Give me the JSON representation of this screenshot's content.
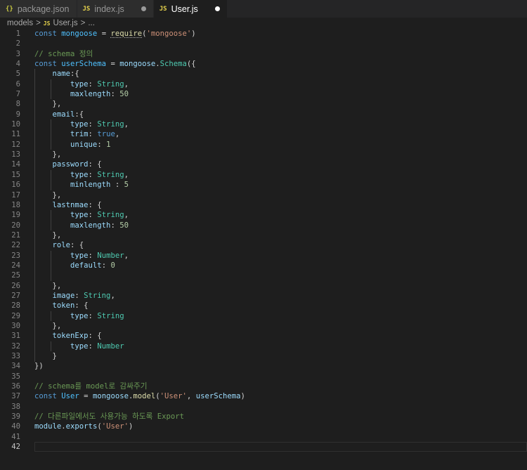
{
  "tabs": [
    {
      "icon": "{}",
      "label": "package.json",
      "active": false,
      "dirty": false
    },
    {
      "icon": "JS",
      "label": "index.js",
      "active": false,
      "dirty": true
    },
    {
      "icon": "JS",
      "label": "User.js",
      "active": true,
      "dirty": true
    }
  ],
  "breadcrumb": {
    "folder": "models",
    "sep": ">",
    "file_icon": "JS",
    "file": "User.js",
    "more": "..."
  },
  "editor": {
    "current_line": 42,
    "lines": [
      [
        [
          "kw",
          "const "
        ],
        [
          "var",
          "mongoose"
        ],
        [
          "pun",
          " = "
        ],
        [
          "fnsq",
          "require"
        ],
        [
          "pun",
          "("
        ],
        [
          "str",
          "'mongoose'"
        ],
        [
          "pun",
          ")"
        ]
      ],
      [],
      [
        [
          "cmt",
          "// schema 정의"
        ]
      ],
      [
        [
          "kw",
          "const "
        ],
        [
          "var",
          "userSchema"
        ],
        [
          "pun",
          " = "
        ],
        [
          "prop",
          "mongoose"
        ],
        [
          "pun",
          "."
        ],
        [
          "cls",
          "Schema"
        ],
        [
          "pun",
          "({"
        ]
      ],
      [
        [
          "pun",
          "    "
        ],
        [
          "prop",
          "name"
        ],
        [
          "pun",
          ":{"
        ]
      ],
      [
        [
          "pun",
          "        "
        ],
        [
          "prop",
          "type"
        ],
        [
          "pun",
          ": "
        ],
        [
          "cls",
          "String"
        ],
        [
          "pun",
          ","
        ]
      ],
      [
        [
          "pun",
          "        "
        ],
        [
          "prop",
          "maxlength"
        ],
        [
          "pun",
          ": "
        ],
        [
          "num",
          "50"
        ]
      ],
      [
        [
          "pun",
          "    },"
        ]
      ],
      [
        [
          "pun",
          "    "
        ],
        [
          "prop",
          "email"
        ],
        [
          "pun",
          ":{"
        ]
      ],
      [
        [
          "pun",
          "        "
        ],
        [
          "prop",
          "type"
        ],
        [
          "pun",
          ": "
        ],
        [
          "cls",
          "String"
        ],
        [
          "pun",
          ","
        ]
      ],
      [
        [
          "pun",
          "        "
        ],
        [
          "prop",
          "trim"
        ],
        [
          "pun",
          ": "
        ],
        [
          "kw",
          "true"
        ],
        [
          "pun",
          ","
        ]
      ],
      [
        [
          "pun",
          "        "
        ],
        [
          "prop",
          "unique"
        ],
        [
          "pun",
          ": "
        ],
        [
          "num",
          "1"
        ]
      ],
      [
        [
          "pun",
          "    },"
        ]
      ],
      [
        [
          "pun",
          "    "
        ],
        [
          "prop",
          "password"
        ],
        [
          "pun",
          ": {"
        ]
      ],
      [
        [
          "pun",
          "        "
        ],
        [
          "prop",
          "type"
        ],
        [
          "pun",
          ": "
        ],
        [
          "cls",
          "String"
        ],
        [
          "pun",
          ","
        ]
      ],
      [
        [
          "pun",
          "        "
        ],
        [
          "prop",
          "minlength"
        ],
        [
          "pun",
          " : "
        ],
        [
          "num",
          "5"
        ]
      ],
      [
        [
          "pun",
          "    },"
        ]
      ],
      [
        [
          "pun",
          "    "
        ],
        [
          "prop",
          "lastnmae"
        ],
        [
          "pun",
          ": {"
        ]
      ],
      [
        [
          "pun",
          "        "
        ],
        [
          "prop",
          "type"
        ],
        [
          "pun",
          ": "
        ],
        [
          "cls",
          "String"
        ],
        [
          "pun",
          ","
        ]
      ],
      [
        [
          "pun",
          "        "
        ],
        [
          "prop",
          "maxlength"
        ],
        [
          "pun",
          ": "
        ],
        [
          "num",
          "50"
        ]
      ],
      [
        [
          "pun",
          "    },"
        ]
      ],
      [
        [
          "pun",
          "    "
        ],
        [
          "prop",
          "role"
        ],
        [
          "pun",
          ": {"
        ]
      ],
      [
        [
          "pun",
          "        "
        ],
        [
          "prop",
          "type"
        ],
        [
          "pun",
          ": "
        ],
        [
          "cls",
          "Number"
        ],
        [
          "pun",
          ","
        ]
      ],
      [
        [
          "pun",
          "        "
        ],
        [
          "prop",
          "default"
        ],
        [
          "pun",
          ": "
        ],
        [
          "num",
          "0"
        ]
      ],
      [],
      [
        [
          "pun",
          "    },"
        ]
      ],
      [
        [
          "pun",
          "    "
        ],
        [
          "prop",
          "image"
        ],
        [
          "pun",
          ": "
        ],
        [
          "cls",
          "String"
        ],
        [
          "pun",
          ","
        ]
      ],
      [
        [
          "pun",
          "    "
        ],
        [
          "prop",
          "token"
        ],
        [
          "pun",
          ": {"
        ]
      ],
      [
        [
          "pun",
          "        "
        ],
        [
          "prop",
          "type"
        ],
        [
          "pun",
          ": "
        ],
        [
          "cls",
          "String"
        ]
      ],
      [
        [
          "pun",
          "    },"
        ]
      ],
      [
        [
          "pun",
          "    "
        ],
        [
          "prop",
          "tokenExp"
        ],
        [
          "pun",
          ": {"
        ]
      ],
      [
        [
          "pun",
          "        "
        ],
        [
          "prop",
          "type"
        ],
        [
          "pun",
          ": "
        ],
        [
          "cls",
          "Number"
        ]
      ],
      [
        [
          "pun",
          "    }"
        ]
      ],
      [
        [
          "pun",
          "})"
        ]
      ],
      [],
      [
        [
          "cmt",
          "// schema를 model로 감싸주기"
        ]
      ],
      [
        [
          "kw",
          "const "
        ],
        [
          "var",
          "User"
        ],
        [
          "pun",
          " = "
        ],
        [
          "prop",
          "mongoose"
        ],
        [
          "pun",
          "."
        ],
        [
          "fn",
          "model"
        ],
        [
          "pun",
          "("
        ],
        [
          "str",
          "'User'"
        ],
        [
          "pun",
          ", "
        ],
        [
          "prop",
          "userSchema"
        ],
        [
          "pun",
          ")"
        ]
      ],
      [],
      [
        [
          "cmt",
          "// 다른파일에서도 사용가능 하도록 Export"
        ]
      ],
      [
        [
          "prop",
          "module"
        ],
        [
          "pun",
          "."
        ],
        [
          "prop",
          "exports"
        ],
        [
          "pun",
          "("
        ],
        [
          "str",
          "'User'"
        ],
        [
          "pun",
          ")"
        ]
      ],
      [],
      []
    ]
  }
}
